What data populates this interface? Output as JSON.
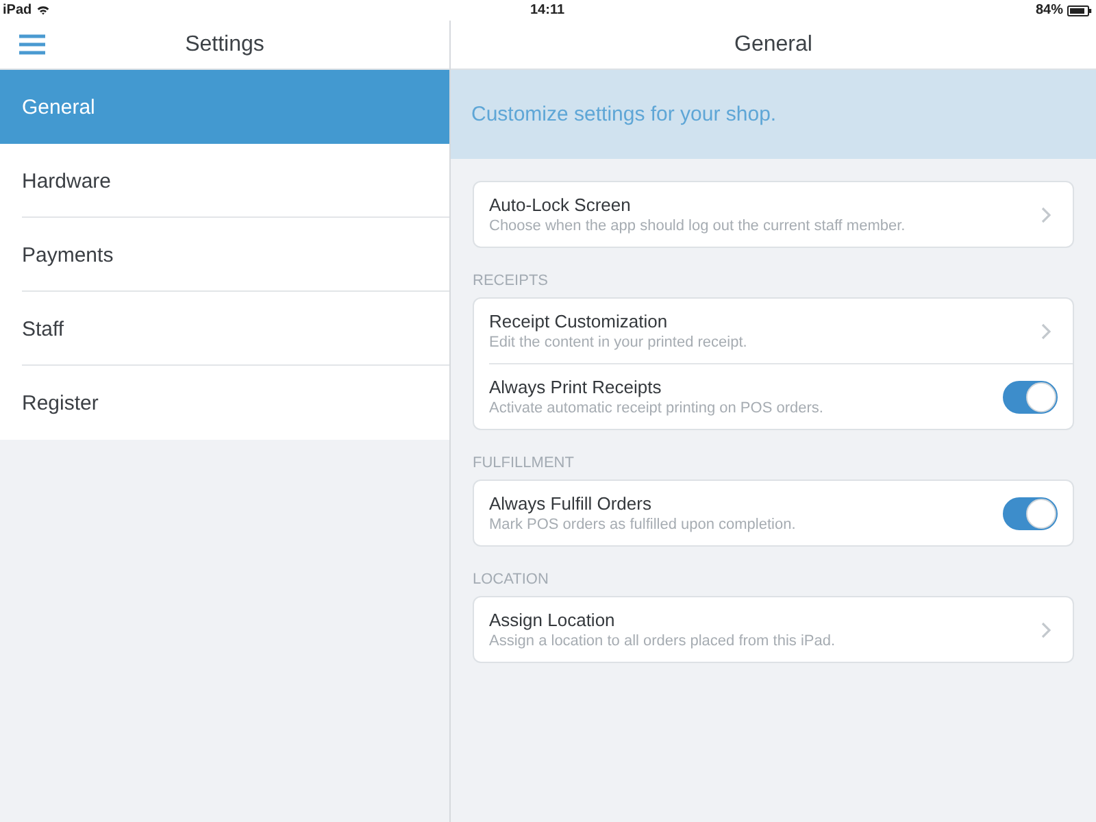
{
  "status_bar": {
    "device": "iPad",
    "time": "14:11",
    "battery": "84%"
  },
  "sidebar": {
    "title": "Settings",
    "items": [
      {
        "label": "General",
        "selected": true
      },
      {
        "label": "Hardware",
        "selected": false
      },
      {
        "label": "Payments",
        "selected": false
      },
      {
        "label": "Staff",
        "selected": false
      },
      {
        "label": "Register",
        "selected": false
      }
    ]
  },
  "detail": {
    "title": "General",
    "banner": "Customize settings for your shop.",
    "sections": [
      {
        "rows": [
          {
            "kind": "link",
            "title": "Auto-Lock Screen",
            "description": "Choose when the app should log out the current staff member."
          }
        ]
      },
      {
        "heading": "RECEIPTS",
        "rows": [
          {
            "kind": "link",
            "title": "Receipt Customization",
            "description": "Edit the content in your printed receipt."
          },
          {
            "kind": "toggle",
            "title": "Always Print Receipts",
            "description": "Activate automatic receipt printing on POS orders.",
            "on": true
          }
        ]
      },
      {
        "heading": "FULFILLMENT",
        "rows": [
          {
            "kind": "toggle",
            "title": "Always Fulfill Orders",
            "description": "Mark POS orders as fulfilled upon completion.",
            "on": true
          }
        ]
      },
      {
        "heading": "LOCATION",
        "rows": [
          {
            "kind": "link",
            "title": "Assign Location",
            "description": "Assign a location to all orders placed from this iPad."
          }
        ]
      }
    ]
  }
}
